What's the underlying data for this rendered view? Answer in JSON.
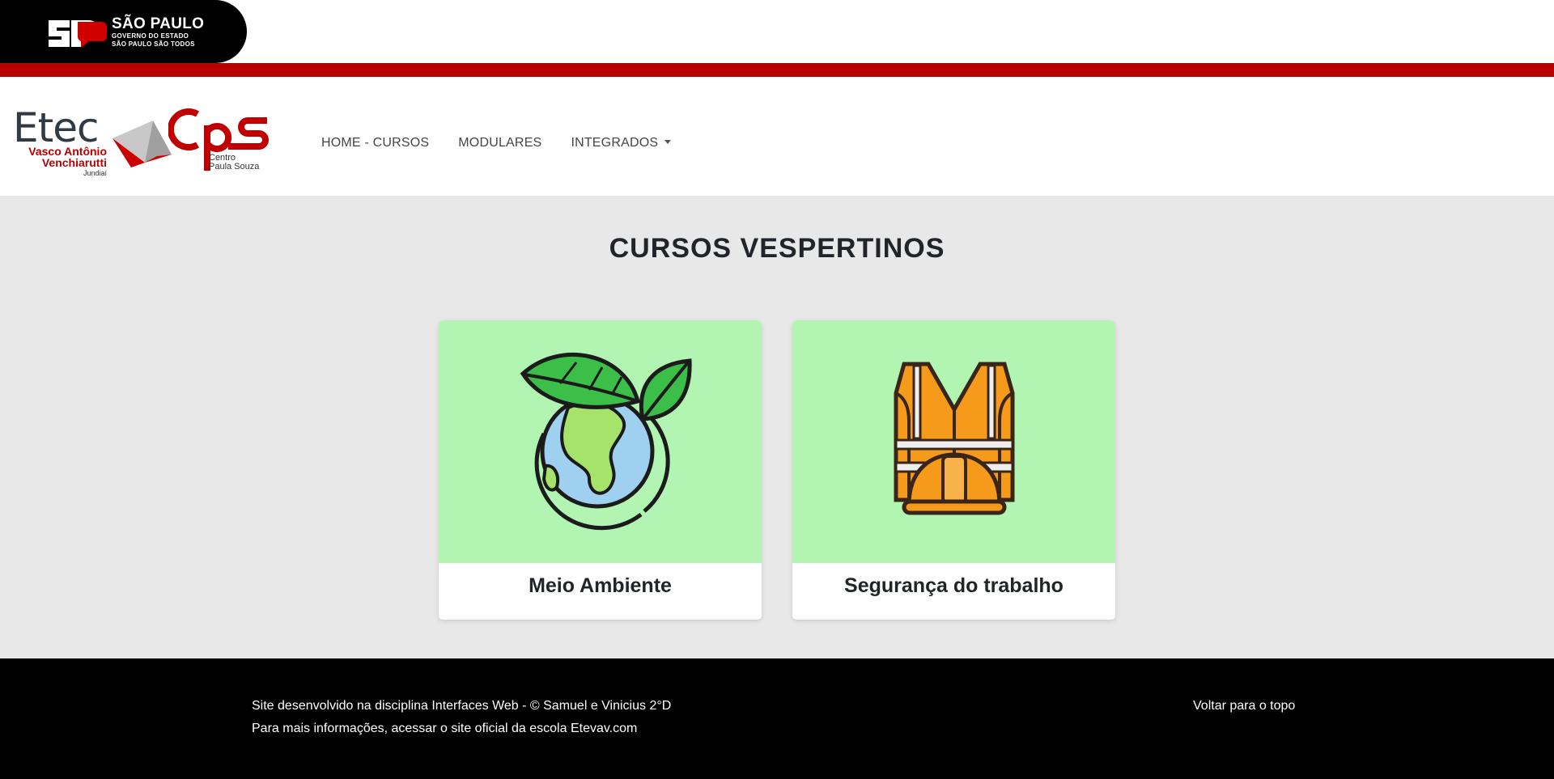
{
  "gov_bar": {
    "state": "SÃO PAULO",
    "line1": "GOVERNO DO ESTADO",
    "line2": "SÃO PAULO SÃO TODOS",
    "logo_mark": "SP",
    "stripe_color": "#b80000"
  },
  "navbar": {
    "etec_logo": {
      "word": "Etec",
      "name_line1": "Vasco Antônio",
      "name_line2": "Venchiarutti",
      "city": "Jundiaí"
    },
    "cps_logo": {
      "mark": "cps",
      "sub_line1": "Centro",
      "sub_line2": "Paula Souza"
    },
    "links": [
      {
        "label": "HOME - CURSOS"
      },
      {
        "label": "MODULARES"
      },
      {
        "label": "INTEGRADOS",
        "has_dropdown": true
      }
    ]
  },
  "main": {
    "title": "CURSOS VESPERTINOS",
    "card_image_bg": "#b2f5b2",
    "cards": [
      {
        "title": "Meio Ambiente",
        "icon": "earth-leaves-icon"
      },
      {
        "title": "Segurança do trabalho",
        "icon": "safety-vest-helmet-icon"
      }
    ]
  },
  "footer": {
    "line1": "Site desenvolvido na disciplina Interfaces Web - © Samuel e Vinicius 2°D",
    "line2_prefix": "Para mais informações, acessar o site oficial da escola ",
    "line2_link": "Etevav.com",
    "back_to_top": "Voltar para o topo"
  }
}
